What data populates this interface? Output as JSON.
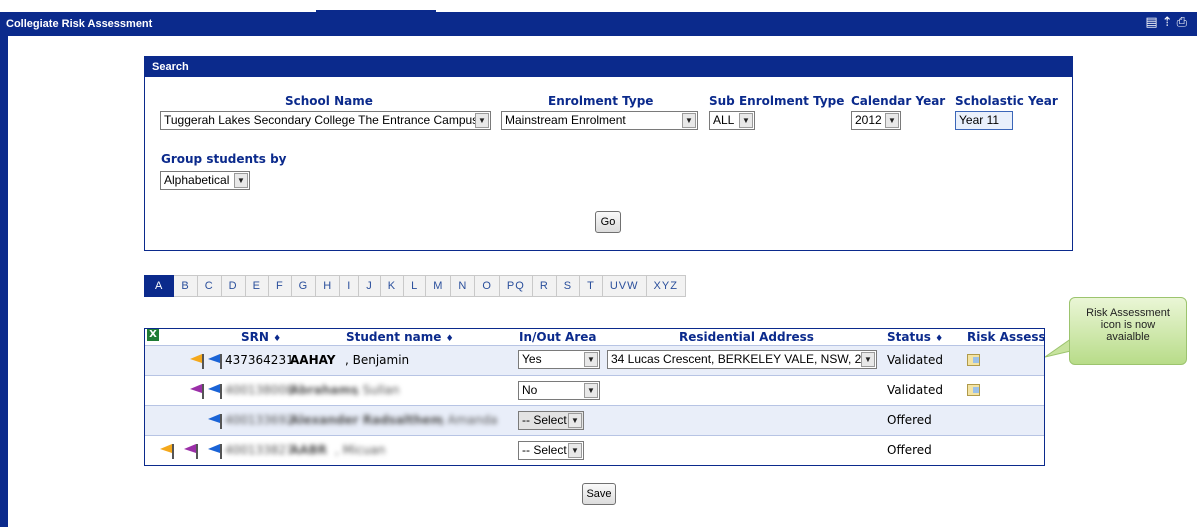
{
  "app": {
    "title": "Collegiate Risk Assessment",
    "tools": [
      "page-icon",
      "up-arrow-icon",
      "print-icon"
    ]
  },
  "search": {
    "header": "Search",
    "school_label": "School Name",
    "school_value": "Tuggerah Lakes Secondary College The Entrance Campus",
    "enrolment_label": "Enrolment Type",
    "enrolment_value": "Mainstream Enrolment",
    "sub_enrolment_label": "Sub Enrolment Type",
    "sub_enrolment_value": "ALL",
    "calendar_label": "Calendar Year",
    "calendar_value": "2012",
    "scholastic_label": "Scholastic Year",
    "scholastic_value": "Year 11",
    "group_label": "Group students by",
    "group_value": "Alphabetical",
    "go_label": "Go"
  },
  "tabs": [
    "A",
    "B",
    "C",
    "D",
    "E",
    "F",
    "G",
    "H",
    "I",
    "J",
    "K",
    "L",
    "M",
    "N",
    "O",
    "PQ",
    "R",
    "S",
    "T",
    "UVW",
    "XYZ"
  ],
  "table": {
    "headers": {
      "srn": "SRN",
      "name": "Student name",
      "area": "In/Out Area",
      "address": "Residential Address",
      "status": "Status",
      "risk": "Risk Assess"
    },
    "sort_glyph": "♦",
    "rows": [
      {
        "srn": "437364231",
        "surname": "AAHAY",
        "given": ", Benjamin",
        "area": "Yes",
        "address": "34 Lucas Crescent, BERKELEY VALE, NSW, 2",
        "status": "Validated",
        "flags": [
          "orange",
          "blue"
        ]
      },
      {
        "srn": "400138008",
        "surname": "Abrahams",
        "given": ", Sullan",
        "area": "No",
        "address": "",
        "status": "Validated",
        "flags": [
          "purple",
          "blue"
        ]
      },
      {
        "srn": "400133692",
        "surname": "Alexander Radsalthem",
        "given": ", Amanda",
        "area": "-- Select --",
        "address": "",
        "status": "Offered",
        "flags": [
          "blue"
        ]
      },
      {
        "srn": "400133827",
        "surname": "AABR",
        "given": ", Micuan",
        "area": "-- Select --",
        "address": "",
        "status": "Offered",
        "flags": [
          "orange",
          "purple",
          "blue"
        ]
      }
    ],
    "save_label": "Save"
  },
  "callout": {
    "text_line1": "Risk Assessment",
    "text_line2": "icon is now",
    "text_line3": "avaialble"
  },
  "colors": {
    "brand": "#0b2a8c",
    "flag_orange": "#f4a81c",
    "flag_purple": "#9b2fa8",
    "flag_blue": "#1a63d6",
    "callout_bg": "#c7e39e"
  }
}
